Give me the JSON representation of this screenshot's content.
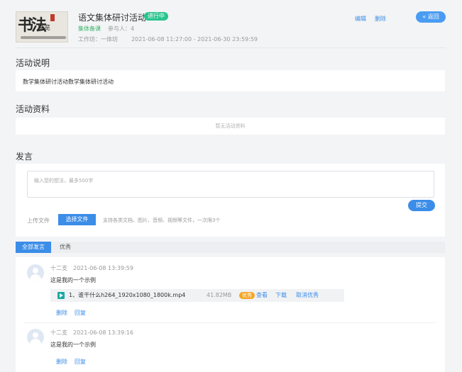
{
  "header": {
    "cover_text": "书法展览",
    "cover_big": "书法",
    "cover_small": "展览",
    "title": "语文集体研讨活动",
    "status": "进行中",
    "type": "集体备课",
    "participants_label": "参与人：4",
    "workshop": "工作坊：一体坊",
    "time_range": "2021-06-08 11:27:00 - 2021-06-30 23:59:59",
    "edit": "编辑",
    "delete": "删除",
    "back": "« 返回"
  },
  "description": {
    "title": "活动说明",
    "content": "数学集体研讨活动数学集体研讨活动"
  },
  "materials": {
    "title": "活动资料",
    "empty": "暂无活动资料"
  },
  "speak": {
    "title": "发言",
    "placeholder": "输入您的想法，最多500字",
    "submit": "提交",
    "upload_label": "上传文件",
    "upload_button": "选择文件",
    "upload_hint": "支持各类文档、图片、音频、视频等文件，一次限3个"
  },
  "tabs": [
    {
      "label": "全部发言"
    },
    {
      "label": "优秀"
    }
  ],
  "posts": [
    {
      "author": "十二支",
      "time": "2021-06-08 13:39:59",
      "text": "这是我的一个示例",
      "file": {
        "name": "1、谁干什么h264_1920x1080_1800k.mp4",
        "size": "41.82MB",
        "badge": "优秀",
        "view": "查看",
        "download": "下载",
        "cancel": "取消优秀"
      },
      "actions": {
        "delete": "删除",
        "reply": "回复"
      }
    },
    {
      "author": "十二支",
      "time": "2021-06-08 13:39:16",
      "text": "这是我的一个示例",
      "actions": {
        "delete": "删除",
        "reply": "回复"
      }
    }
  ],
  "colors": {
    "primary": "#3b8de8",
    "status_green": "#29c48e",
    "type_green": "#3db26a",
    "badge_orange": "#f5a623",
    "video_icon": "#19a9a3"
  }
}
